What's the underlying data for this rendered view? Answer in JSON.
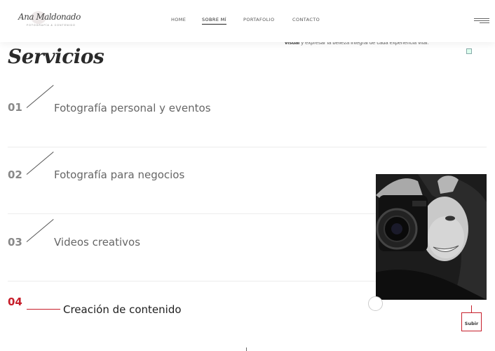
{
  "header": {
    "logo_script": "Ana Maldonado",
    "logo_tagline": "FOTOGRAFÍA & CONTENIDO",
    "nav": [
      {
        "label": "HOME",
        "active": false
      },
      {
        "label": "SOBRE MÍ",
        "active": true
      },
      {
        "label": "PORTAFOLIO",
        "active": false
      },
      {
        "label": "CONTACTO",
        "active": false
      }
    ],
    "menu_icon": "hamburger-icon"
  },
  "snippet": {
    "bold": "visual",
    "rest": " y expresar la belleza integral de cada experiencia vital."
  },
  "section_title": "Servicios",
  "services": [
    {
      "number": "01",
      "label": "Fotografía personal y eventos",
      "active": false
    },
    {
      "number": "02",
      "label": "Fotografía para negocios",
      "active": false
    },
    {
      "number": "03",
      "label": "Videos creativos",
      "active": false
    },
    {
      "number": "04",
      "label": "Creación de contenido",
      "active": true
    }
  ],
  "photo": {
    "icon": "woman-with-camera-photo"
  },
  "back_to_top": {
    "label": "Subir"
  },
  "colors": {
    "accent": "#c71f2b",
    "text": "#333333",
    "muted": "#888888"
  }
}
